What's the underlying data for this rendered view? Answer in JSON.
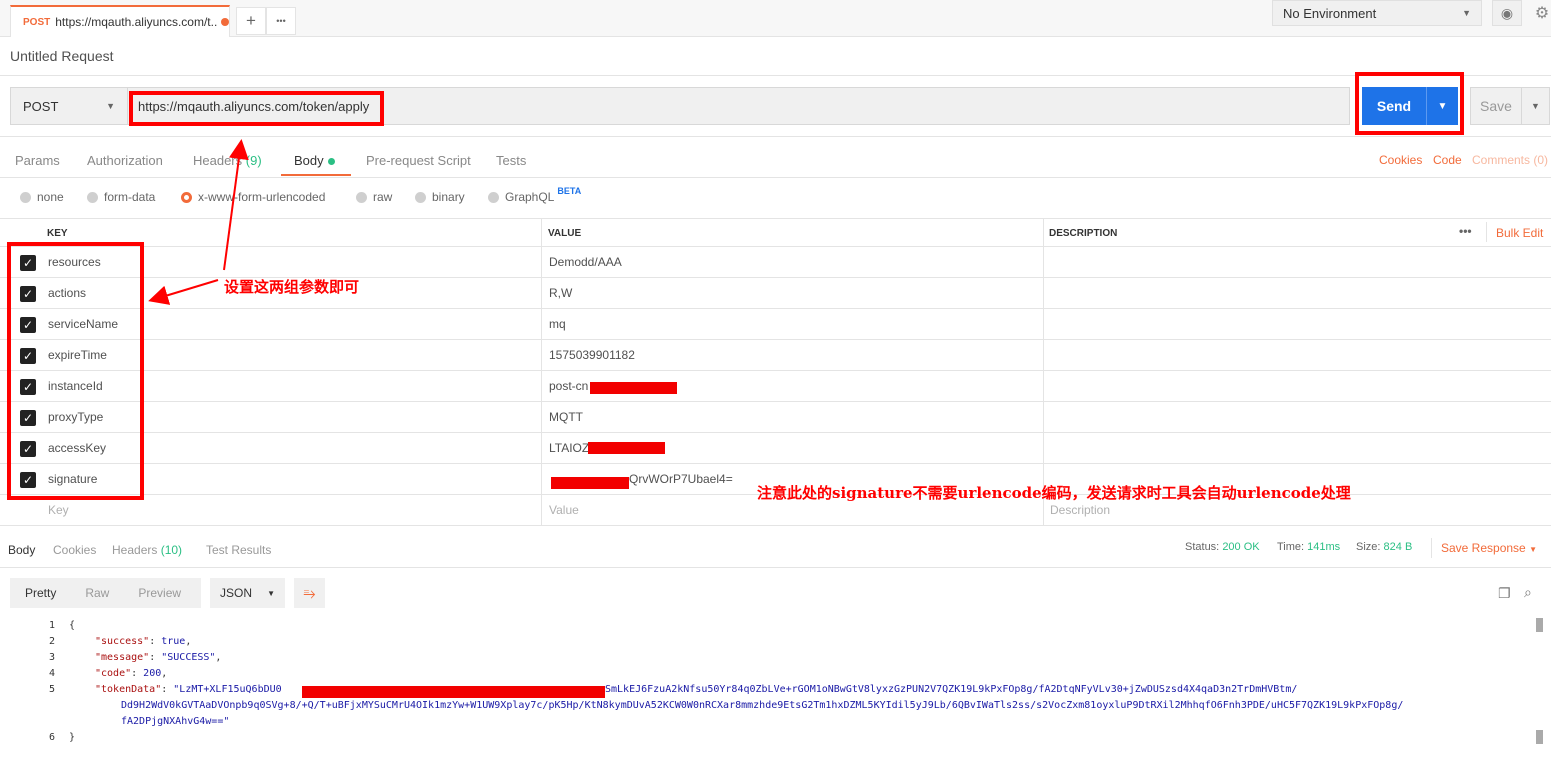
{
  "tabbar": {
    "tab_method": "POST",
    "tab_url": "https://mqauth.aliyuncs.com/t...",
    "add_label": "+",
    "more_label": "•••",
    "environment": "No Environment"
  },
  "request": {
    "title": "Untitled Request",
    "method": "POST",
    "url": "https://mqauth.aliyuncs.com/token/apply",
    "send_label": "Send",
    "save_label": "Save"
  },
  "request_tabs": {
    "params": "Params",
    "authorization": "Authorization",
    "headers": "Headers",
    "headers_count": "(9)",
    "body": "Body",
    "prerequest": "Pre-request Script",
    "tests": "Tests",
    "cookies": "Cookies",
    "code": "Code",
    "comments": "Comments (0)"
  },
  "body_types": {
    "none": "none",
    "form_data": "form-data",
    "urlencoded": "x-www-form-urlencoded",
    "raw": "raw",
    "binary": "binary",
    "graphql": "GraphQL",
    "beta": "BETA",
    "selected": "x-www-form-urlencoded"
  },
  "table": {
    "key_header": "KEY",
    "value_header": "VALUE",
    "description_header": "DESCRIPTION",
    "more_label": "•••",
    "bulk_edit": "Bulk Edit",
    "rows": [
      {
        "key": "resources",
        "value": "Demodd/AAA"
      },
      {
        "key": "actions",
        "value": "R,W"
      },
      {
        "key": "serviceName",
        "value": "mq"
      },
      {
        "key": "expireTime",
        "value": "1575039901182"
      },
      {
        "key": "instanceId",
        "value": "post-cn"
      },
      {
        "key": "proxyType",
        "value": "MQTT"
      },
      {
        "key": "accessKey",
        "value": "LTAIOZ"
      },
      {
        "key": "signature",
        "value": "QrvWOrP7Ubael4="
      }
    ],
    "placeholder_key": "Key",
    "placeholder_value": "Value",
    "placeholder_description": "Description"
  },
  "response": {
    "tabs": {
      "body": "Body",
      "cookies": "Cookies",
      "headers": "Headers",
      "headers_count": "(10)",
      "test_results": "Test Results"
    },
    "status_label": "Status:",
    "status_value": "200 OK",
    "time_label": "Time:",
    "time_value": "141ms",
    "size_label": "Size:",
    "size_value": "824 B",
    "save_response": "Save Response",
    "view": {
      "pretty": "Pretty",
      "raw": "Raw",
      "preview": "Preview",
      "format": "JSON"
    },
    "lines": {
      "l1": "{",
      "l2_key": "\"success\"",
      "l2_val": "true",
      "l3_key": "\"message\"",
      "l3_val": "\"SUCCESS\"",
      "l4_key": "\"code\"",
      "l4_val": "200",
      "l5_key": "\"tokenData\"",
      "l5_a": "\"LzMT+XLF15uQ6bDU0",
      "l5_b": "SmLkEJ6FzuA2kNfsu50Yr84q0ZbLVe+rGOM1oNBwGtV8lyxzGzPUN2V7QZK19L9kPxFOp8g/fA2DtqNFyVLv30+jZwDUSzsd4X4qaD3n2TrDmHVBtm/",
      "l5_c": "Dd9H2WdV0kGVTAaDVOnpb9q0SVg+8/+Q/T+uBFjxMYSuCMrU4OIk1mzYw+W1UW9Xplay7c/pK5Hp/KtN8kymDUvA52KCW0W0nRCXar8mmzhde9EtsG2Tm1hxDZML5KYIdil5yJ9Lb/6QBvIWaTls2ss/s2VocZxm81oyxluP9DtRXil2MhhqfO6Fnh3PDE/uHC5F7QZK19L9kPxFOp8g/",
      "l5_d": "fA2DPjgNXAhvG4w==\"",
      "l6": "}"
    }
  },
  "annotations": {
    "params_note": "设置这两组参数即可",
    "signature_note": "注意此处的signature不需要urlencode编码，发送请求时工具会自动urlencode处理"
  },
  "colors": {
    "accent": "#f26b3a",
    "send": "#1e73e8",
    "success": "#2bbf84",
    "annotation": "#ff0000"
  }
}
